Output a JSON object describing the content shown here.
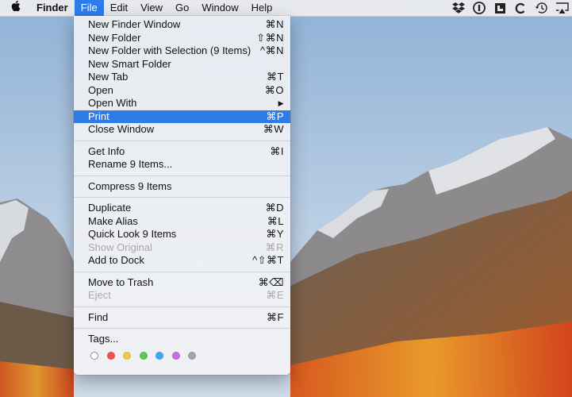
{
  "menubar": {
    "apple_icon": "apple-logo-icon",
    "items": [
      {
        "label": "Finder"
      },
      {
        "label": "File"
      },
      {
        "label": "Edit"
      },
      {
        "label": "View"
      },
      {
        "label": "Go"
      },
      {
        "label": "Window"
      },
      {
        "label": "Help"
      }
    ],
    "active": "File",
    "status_icons": [
      "dropbox-icon",
      "1password-icon",
      "bartender-icon",
      "c-icon",
      "time-machine-icon",
      "airplay-icon"
    ]
  },
  "file_menu": {
    "groups": [
      [
        {
          "label": "New Finder Window",
          "shortcut": "⌘N"
        },
        {
          "label": "New Folder",
          "shortcut": "⇧⌘N"
        },
        {
          "label": "New Folder with Selection (9 Items)",
          "shortcut": "^⌘N"
        },
        {
          "label": "New Smart Folder",
          "shortcut": ""
        },
        {
          "label": "New Tab",
          "shortcut": "⌘T"
        },
        {
          "label": "Open",
          "shortcut": "⌘O"
        },
        {
          "label": "Open With",
          "shortcut": "▶"
        },
        {
          "label": "Print",
          "shortcut": "⌘P",
          "highlighted": true
        },
        {
          "label": "Close Window",
          "shortcut": "⌘W"
        }
      ],
      [
        {
          "label": "Get Info",
          "shortcut": "⌘I"
        },
        {
          "label": "Rename 9 Items...",
          "shortcut": ""
        }
      ],
      [
        {
          "label": "Compress 9 Items",
          "shortcut": ""
        }
      ],
      [
        {
          "label": "Duplicate",
          "shortcut": "⌘D"
        },
        {
          "label": "Make Alias",
          "shortcut": "⌘L"
        },
        {
          "label": "Quick Look 9 Items",
          "shortcut": "⌘Y"
        },
        {
          "label": "Show Original",
          "shortcut": "⌘R",
          "disabled": true
        },
        {
          "label": "Add to Dock",
          "shortcut": "^⇧⌘T"
        }
      ],
      [
        {
          "label": "Move to Trash",
          "shortcut": "⌘⌫"
        },
        {
          "label": "Eject",
          "shortcut": "⌘E",
          "disabled": true
        }
      ],
      [
        {
          "label": "Find",
          "shortcut": "⌘F"
        }
      ],
      [
        {
          "label": "Tags...",
          "shortcut": ""
        }
      ]
    ],
    "tag_colors": [
      {
        "name": "none",
        "color": "#ffffff"
      },
      {
        "name": "red",
        "color": "#f0504f"
      },
      {
        "name": "orange",
        "color": "#f5c843"
      },
      {
        "name": "green",
        "color": "#5bc94f"
      },
      {
        "name": "blue",
        "color": "#3eaaf0"
      },
      {
        "name": "purple",
        "color": "#c471e0"
      },
      {
        "name": "gray",
        "color": "#a4a4a8"
      }
    ]
  }
}
